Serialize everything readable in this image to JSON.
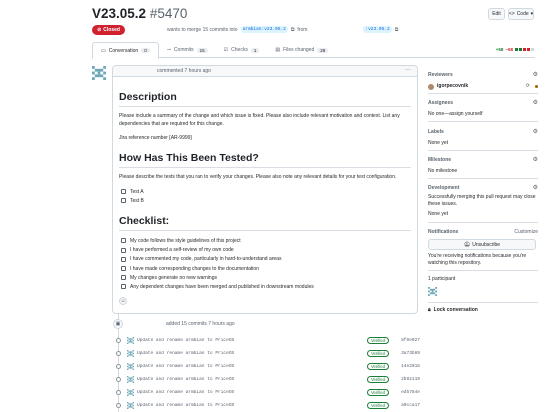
{
  "pr": {
    "title": "V23.05.2",
    "number": "#5470",
    "state": "Closed",
    "meta_text": "wants to merge 15 commits into",
    "base_branch": "armbian:v23.05.2",
    "from_text": "from",
    "head_branch": ":v23.05.2"
  },
  "header_buttons": {
    "edit": "Edit",
    "code": "Code"
  },
  "tabs": [
    {
      "label": "Conversation",
      "count": "0",
      "icon": "comment-icon"
    },
    {
      "label": "Commits",
      "count": "15",
      "icon": "commit-icon"
    },
    {
      "label": "Checks",
      "count": "1",
      "icon": "checks-icon"
    },
    {
      "label": "Files changed",
      "count": "29",
      "icon": "file-diff-icon"
    }
  ],
  "diffstat": {
    "additions": "+58",
    "deletions": "−58"
  },
  "comment": {
    "header": "commented 7 hours ago",
    "h_description": "Description",
    "p_description": "Please include a summary of the change and which issue is fixed. Please also include relevant motivation and context. List any dependencies that are required for this change.",
    "p_jira": "Jira reference number [AR-9999]",
    "h_tested": "How Has This Been Tested?",
    "p_tested": "Please describe the tests that you ran to verify your changes. Please also note any relevant details for your test configuration.",
    "tests": [
      "Test A",
      "Test B"
    ],
    "h_checklist": "Checklist:",
    "checklist": [
      "My code follows the style guidelines of this project",
      "I have performed a self-review of my own code",
      "I have commented my code, particularly in hard-to-understand areas",
      "I have made corresponding changes to the documentation",
      "My changes generate no new warnings",
      "Any dependent changes have been merged and published in downstream modules"
    ]
  },
  "timeline": {
    "added": "added 15 commits 7 hours ago",
    "commits": [
      {
        "message": "Update and rename armbian to PriceOS",
        "badge": "Verified",
        "sha": "8f0e027"
      },
      {
        "message": "Update and rename armbian to PriceOS",
        "badge": "Verified",
        "sha": "3a73b89"
      },
      {
        "message": "Update and rename armbian to PriceOS",
        "badge": "Verified",
        "sha": "14e2016"
      },
      {
        "message": "Update and rename armbian to PriceOS",
        "badge": "Verified",
        "sha": "2b92119"
      },
      {
        "message": "Update and rename armbian to PriceOS",
        "badge": "Verified",
        "sha": "ed5784e"
      },
      {
        "message": "Update and rename armbian to PriceOS",
        "badge": "Verified",
        "sha": "a0cca17"
      }
    ]
  },
  "sidebar": {
    "reviewers": {
      "label": "Reviewers",
      "name": "igorpecovnik"
    },
    "assignees": {
      "label": "Assignees",
      "value": "No one—assign yourself"
    },
    "labels": {
      "label": "Labels",
      "value": "None yet"
    },
    "milestone": {
      "label": "Milestone",
      "value": "No milestone"
    },
    "development": {
      "label": "Development",
      "value": "Successfully merging this pull request may close these issues.",
      "value2": "None yet"
    },
    "notifications": {
      "label": "Notifications",
      "customize": "Customize",
      "button": "Unsubscribe",
      "note": "You're receiving notifications because you're watching this repository."
    },
    "participants": {
      "label": "1 participant"
    },
    "lock": "Lock conversation"
  },
  "colors": {
    "closed": "#cf222e",
    "link": "#0969da",
    "verified": "#1a7f37"
  }
}
